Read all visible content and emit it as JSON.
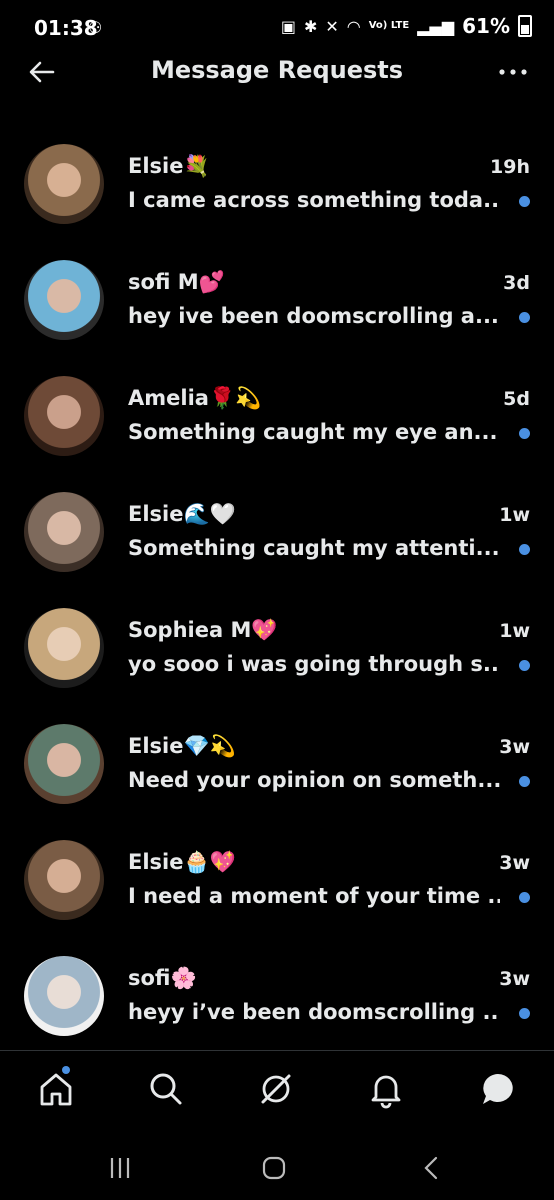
{
  "status": {
    "time": "01:38",
    "signal_text": "Vo) LTE",
    "battery": "61%"
  },
  "header": {
    "title": "Message Requests"
  },
  "requests": [
    {
      "name": "Elsie",
      "emoji": "💐",
      "time": "19h",
      "preview": "I came across something toda...",
      "unread": true,
      "avatar_colors": [
        "#8a6a4c",
        "#d7b093",
        "#3a2a1e"
      ]
    },
    {
      "name": "sofi M",
      "emoji": "💕",
      "time": "3d",
      "preview": "hey ive been doomscrolling a...",
      "unread": true,
      "avatar_colors": [
        "#6fb3d6",
        "#d9b9a6",
        "#2b2b2b"
      ]
    },
    {
      "name": "Amelia",
      "emoji": "🌹💫",
      "time": "5d",
      "preview": "Something caught my eye an...",
      "unread": true,
      "avatar_colors": [
        "#6e4a37",
        "#caa08b",
        "#2d1c14"
      ]
    },
    {
      "name": "Elsie",
      "emoji": "🌊🤍",
      "time": "1w",
      "preview": "Something caught my attenti...",
      "unread": true,
      "avatar_colors": [
        "#7e6a5c",
        "#d8b8a5",
        "#3b2e26"
      ]
    },
    {
      "name": "Sophiea M",
      "emoji": "💖",
      "time": "1w",
      "preview": "yo sooo i was going through s...",
      "unread": true,
      "avatar_colors": [
        "#c7a77c",
        "#e7cdb5",
        "#1c1c1c"
      ]
    },
    {
      "name": "Elsie",
      "emoji": "💎💫",
      "time": "3w",
      "preview": "Need your opinion on someth...",
      "unread": true,
      "avatar_colors": [
        "#5d7a6b",
        "#d9b6a3",
        "#5a4030"
      ]
    },
    {
      "name": "Elsie",
      "emoji": "🧁💖",
      "time": "3w",
      "preview": "I need a moment of your time ...",
      "unread": true,
      "avatar_colors": [
        "#7a5c45",
        "#d5ae94",
        "#3a2a1e"
      ]
    },
    {
      "name": "sofi",
      "emoji": "🌸",
      "time": "3w",
      "preview": "heyy i’ve been doomscrolling ...",
      "unread": true,
      "avatar_colors": [
        "#9fb6c8",
        "#e8ddd6",
        "#f1f1f1"
      ]
    }
  ],
  "nav": {
    "accent": "#4a90e2",
    "items": [
      "home-icon",
      "search-icon",
      "grok-icon",
      "notifications-icon",
      "messages-icon"
    ]
  }
}
